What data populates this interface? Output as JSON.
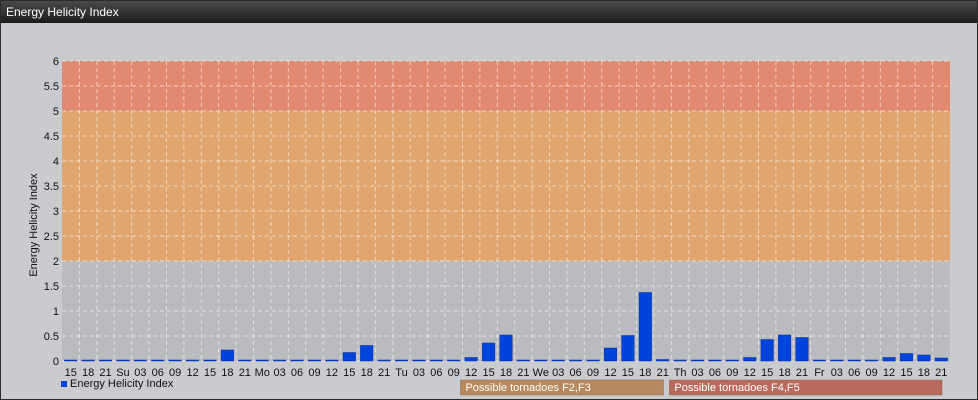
{
  "window": {
    "title": "Energy Helicity Index"
  },
  "chart_data": {
    "type": "bar",
    "ylabel": "Energy Helicity Index",
    "ylim": [
      0,
      6
    ],
    "yticks": [
      "0",
      "0.5",
      "1",
      "1.5",
      "2",
      "2.5",
      "3",
      "3.5",
      "4",
      "4.5",
      "5",
      "5.5",
      "6"
    ],
    "grid": true,
    "categories": [
      "15",
      "18",
      "21",
      "Su",
      "03",
      "06",
      "09",
      "12",
      "15",
      "18",
      "21",
      "Mo",
      "03",
      "06",
      "09",
      "12",
      "15",
      "18",
      "21",
      "Tu",
      "03",
      "06",
      "09",
      "12",
      "15",
      "18",
      "21",
      "We",
      "03",
      "06",
      "09",
      "12",
      "15",
      "18",
      "21",
      "Th",
      "03",
      "06",
      "09",
      "12",
      "15",
      "18",
      "21",
      "Fr",
      "03",
      "06",
      "09",
      "12",
      "15",
      "18",
      "21"
    ],
    "series": [
      {
        "name": "Energy Helicity Index",
        "color": "#0044dd",
        "values": [
          0.02,
          0.02,
          0.02,
          0.02,
          0.02,
          0.02,
          0.02,
          0.02,
          0.02,
          0.22,
          0.02,
          0.02,
          0.02,
          0.02,
          0.02,
          0.02,
          0.17,
          0.31,
          0.02,
          0.02,
          0.02,
          0.02,
          0.02,
          0.07,
          0.36,
          0.52,
          0.02,
          0.02,
          0.02,
          0.02,
          0.02,
          0.26,
          0.51,
          1.37,
          0.03,
          0.02,
          0.02,
          0.02,
          0.02,
          0.07,
          0.43,
          0.52,
          0.47,
          0.02,
          0.02,
          0.02,
          0.02,
          0.07,
          0.15,
          0.12,
          0.06
        ]
      }
    ],
    "zones": [
      {
        "from": 0,
        "to": 2,
        "color": "#b9bbbe"
      },
      {
        "from": 2,
        "to": 5,
        "color": "#e0a66e"
      },
      {
        "from": 5,
        "to": 6,
        "color": "#e28a70"
      }
    ],
    "legend": "bottom-left",
    "band_labels": [
      {
        "text": "Possible tornadoes F2,F3",
        "color": "#b8895e",
        "from_category": 23,
        "to_category": 34
      },
      {
        "text": "Possible tornadoes F4,F5",
        "color": "#b86a5e",
        "from_category": 35,
        "to_category": 50
      }
    ]
  }
}
